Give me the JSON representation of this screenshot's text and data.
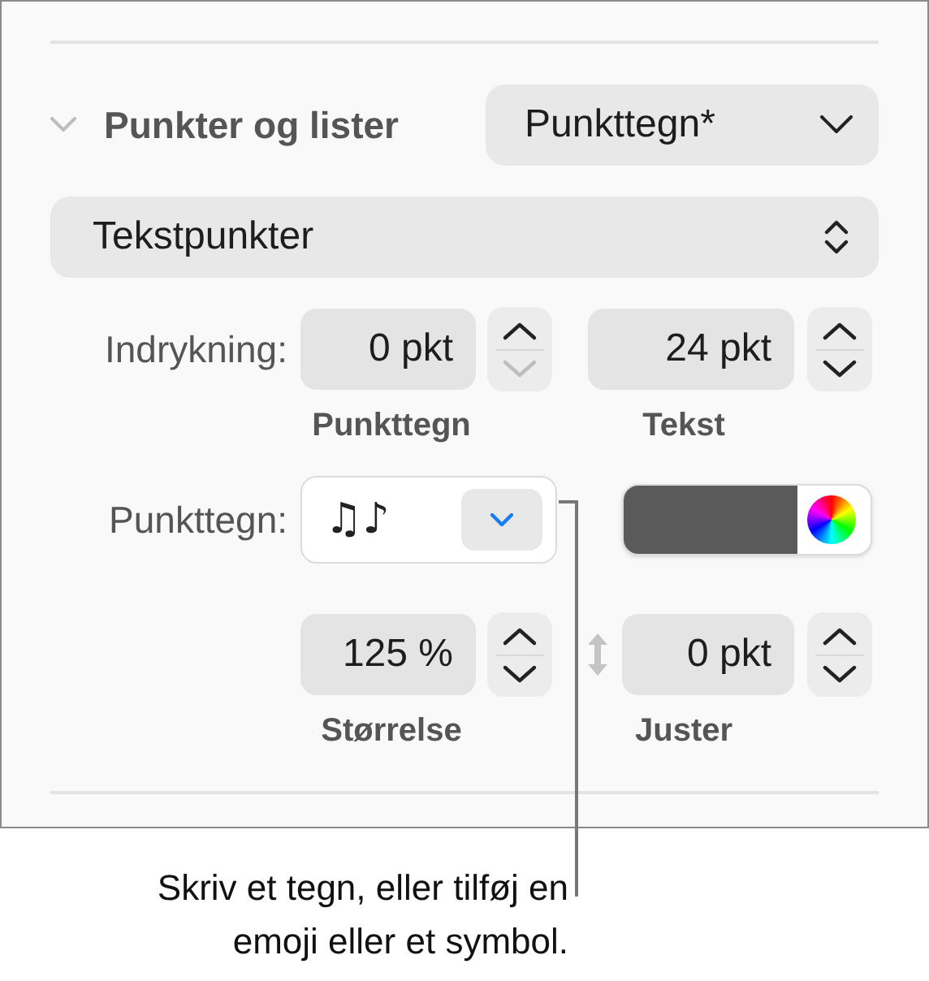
{
  "section": {
    "title": "Punkter og lister",
    "expanded": true,
    "style_menu": "Punkttegn*"
  },
  "list_type": "Tekstpunkter",
  "indent": {
    "label": "Indrykning:",
    "fields": [
      {
        "value": "0 pkt",
        "caption": "Punkttegn",
        "up_disabled": false,
        "down_disabled": true
      },
      {
        "value": "24 pkt",
        "caption": "Tekst",
        "up_disabled": false,
        "down_disabled": false
      }
    ]
  },
  "bullet": {
    "label": "Punkttegn:",
    "value": "♫♪",
    "color": "#5a5a5a"
  },
  "size": {
    "fields": [
      {
        "value": "125 %",
        "caption": "Størrelse",
        "up_disabled": false,
        "down_disabled": false
      },
      {
        "value": "0 pkt",
        "caption": "Juster",
        "up_disabled": false,
        "down_disabled": false
      }
    ]
  },
  "callout": {
    "lines": [
      "Skriv et tegn, eller tilføj en",
      "emoji eller et symbol."
    ]
  }
}
